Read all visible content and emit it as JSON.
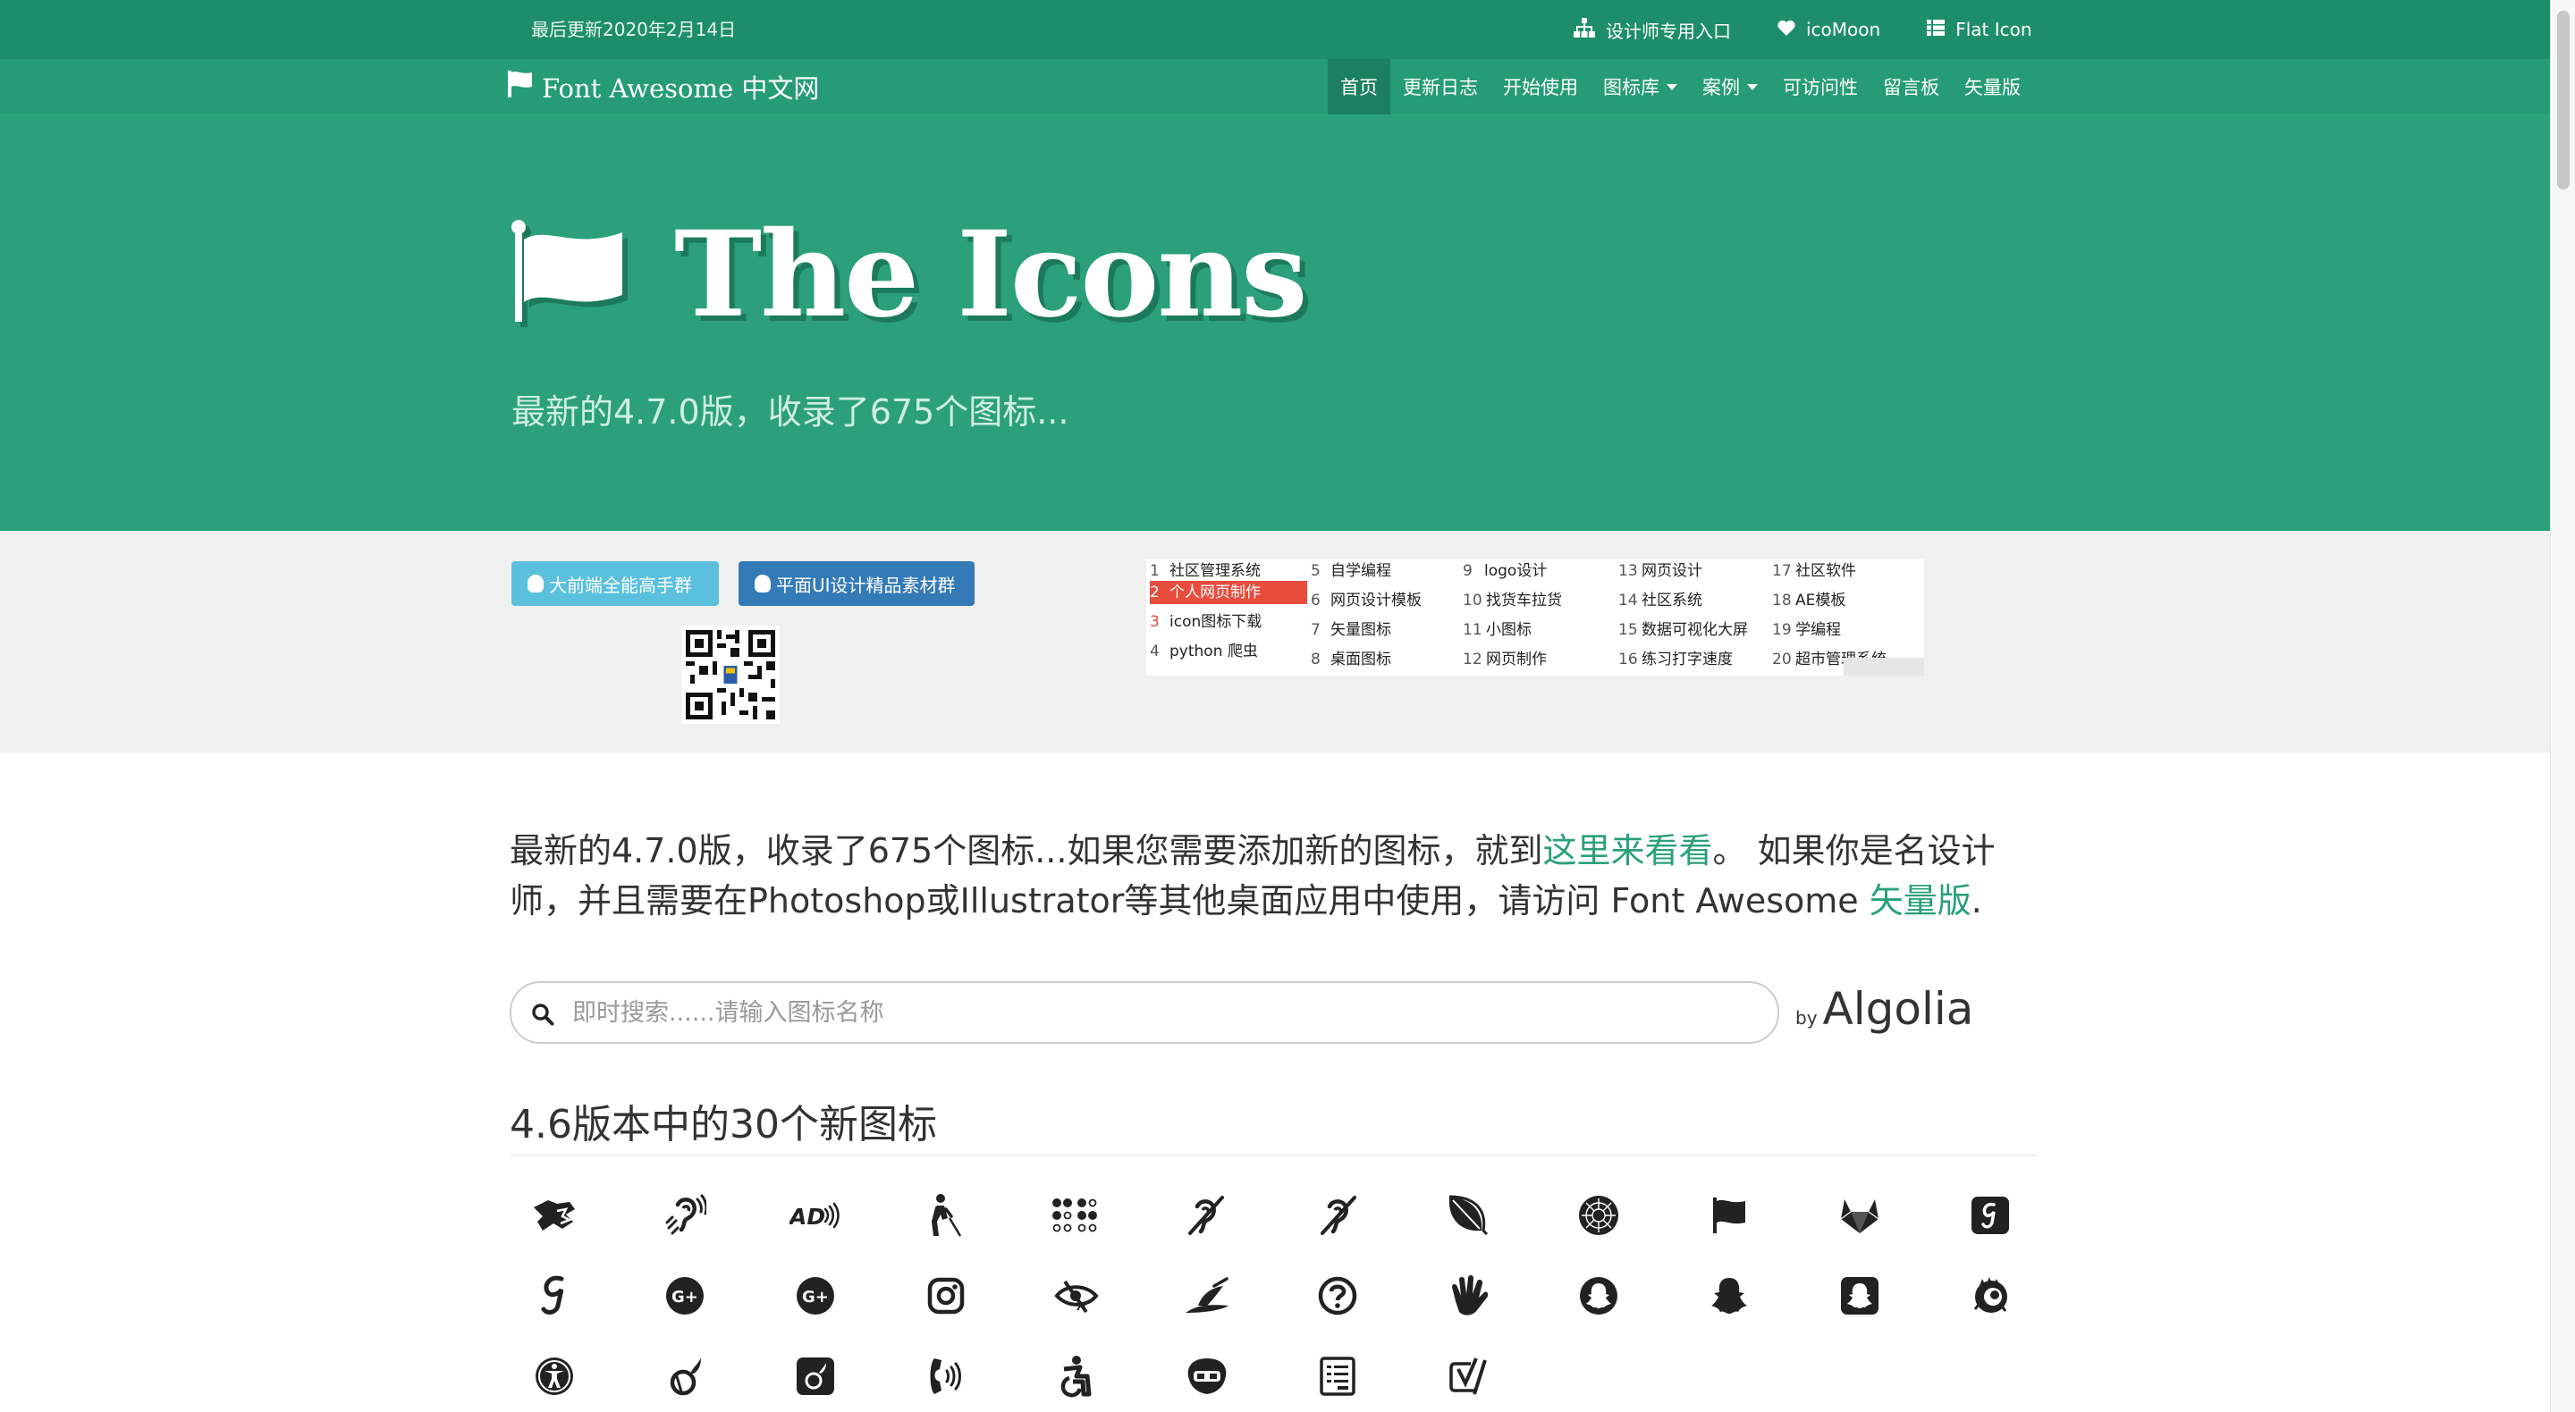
{
  "topbar": {
    "updated": "最后更新2020年2月14日",
    "links": [
      {
        "label": "设计师专用入口",
        "icon": "sitemap-icon"
      },
      {
        "label": "icoMoon",
        "icon": "heart-icon"
      },
      {
        "label": "Flat Icon",
        "icon": "grid-icon"
      }
    ]
  },
  "nav": {
    "brand": "Font Awesome 中文网",
    "items": [
      "首页",
      "更新日志",
      "开始使用",
      "图标库",
      "案例",
      "可访问性",
      "留言板",
      "矢量版"
    ]
  },
  "hero": {
    "title": "The Icons",
    "subtitle": "最新的4.7.0版，收录了675个图标..."
  },
  "band": {
    "btn1": "大前端全能高手群",
    "btn2": "平面UI设计精品素材群",
    "ads": [
      [
        "1",
        "社区管理系统"
      ],
      [
        "2",
        "个人网页制作"
      ],
      [
        "3",
        "icon图标下载"
      ],
      [
        "4",
        "python 爬虫"
      ],
      [
        "5",
        "自学编程"
      ],
      [
        "6",
        "网页设计模板"
      ],
      [
        "7",
        "矢量图标"
      ],
      [
        "8",
        "桌面图标"
      ],
      [
        "9",
        "logo设计"
      ],
      [
        "10",
        "找货车拉货"
      ],
      [
        "11",
        "小图标"
      ],
      [
        "12",
        "网页制作"
      ],
      [
        "13",
        "网页设计"
      ],
      [
        "14",
        "社区系统"
      ],
      [
        "15",
        "数据可视化大屏"
      ],
      [
        "16",
        "练习打字速度"
      ],
      [
        "17",
        "社区软件"
      ],
      [
        "18",
        "AE模板"
      ],
      [
        "19",
        "学编程"
      ],
      [
        "20",
        "超市管理系统"
      ]
    ]
  },
  "intro": {
    "p1": "最新的4.7.0版，收录了675个图标...如果您需要添加新的图标，就到",
    "link1": "这里来看看",
    "p2": "。 如果你是名设计师，并且需要在Photoshop或Illustrator等其他桌面应用中使用，请访问 Font Awesome ",
    "link2": "矢量版",
    "p3": "."
  },
  "search": {
    "placeholder": "即时搜索......请输入图标名称",
    "by": "by",
    "brand": "Algolia"
  },
  "section": {
    "title": "4.6版本中的30个新图标",
    "icons": [
      "asl-interpreting-icon",
      "assistive-listening-icon",
      "audio-description-icon",
      "blind-icon",
      "braille-icon",
      "deaf-icon",
      "deafness-icon",
      "envira-icon",
      "first-order-icon",
      "font-awesome-icon",
      "gitlab-icon",
      "glide-icon",
      "glide-g-icon",
      "google-plus-circle-icon",
      "google-plus-official-icon",
      "instagram-icon",
      "low-vision-icon",
      "pied-piper-icon",
      "question-circle-o-icon",
      "sign-language-icon",
      "snapchat-icon",
      "snapchat-ghost-icon",
      "snapchat-square-icon",
      "themeisle-icon",
      "universal-access-icon",
      "viadeo-icon",
      "viadeo-square-icon",
      "volume-control-phone-icon",
      "wheelchair-alt-icon",
      "wpforms-icon",
      "wpbeginner-icon",
      "yoast-icon"
    ]
  }
}
